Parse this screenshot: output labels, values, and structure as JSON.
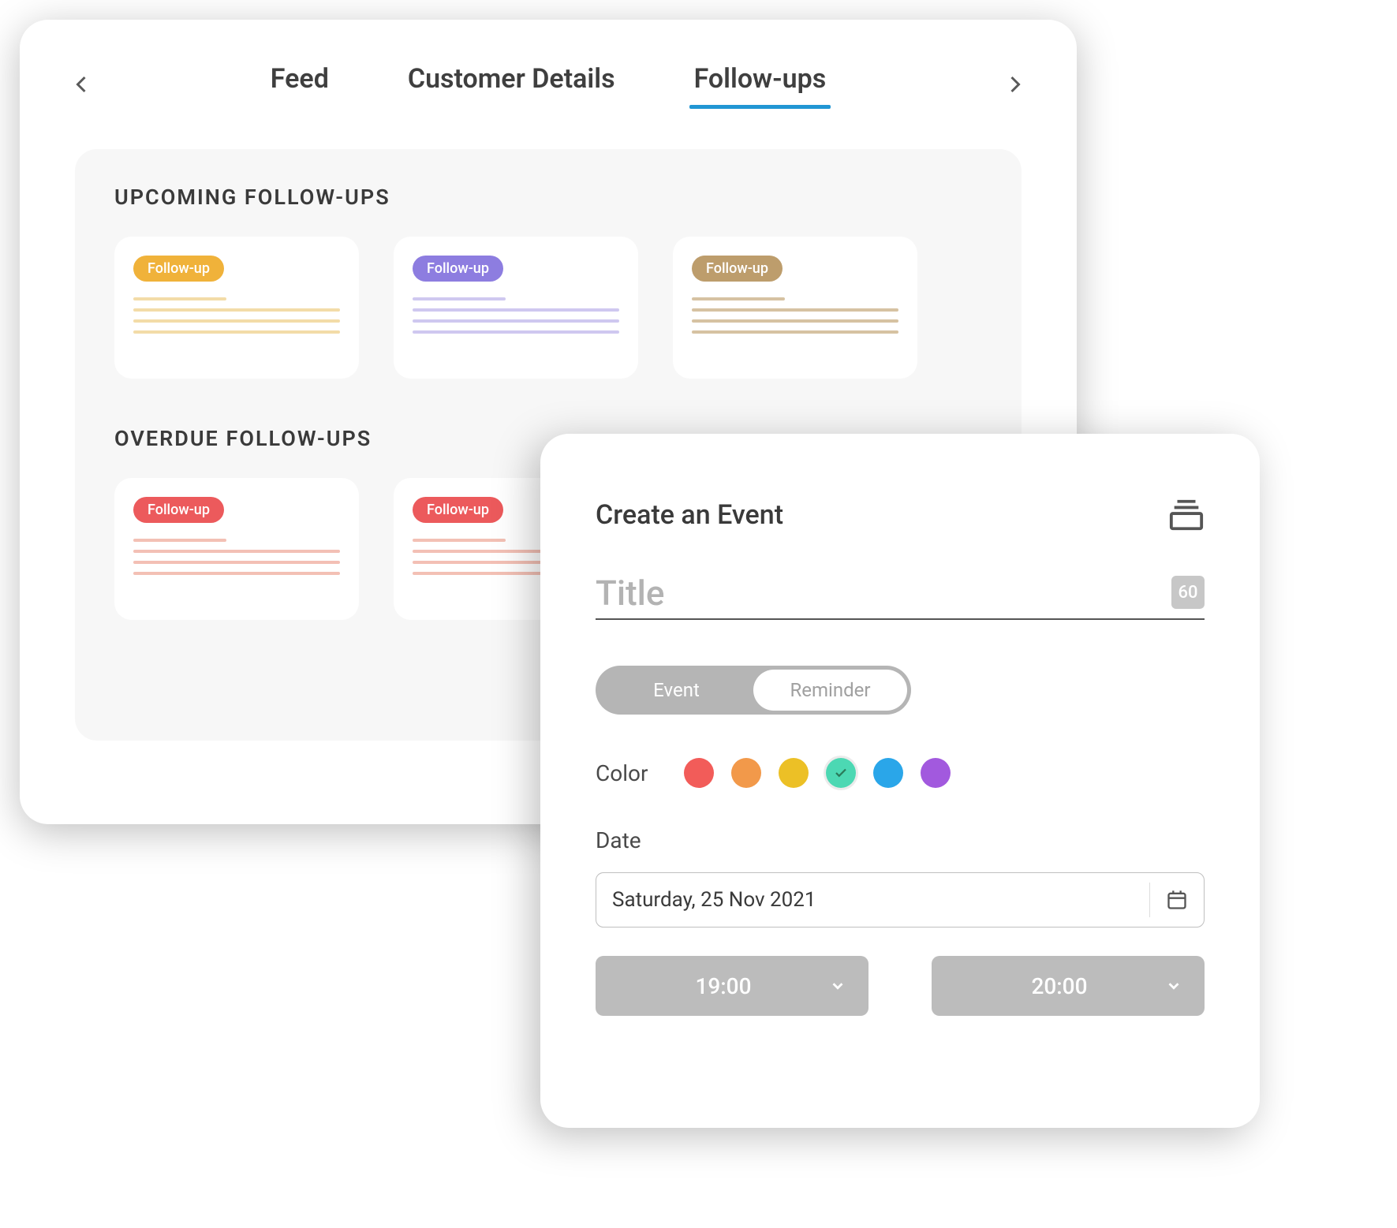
{
  "tabs": {
    "items": [
      {
        "label": "Feed",
        "active": false
      },
      {
        "label": "Customer Details",
        "active": false
      },
      {
        "label": "Follow-ups",
        "active": true
      }
    ]
  },
  "sections": {
    "upcoming": {
      "title": "UPCOMING FOLLOW-UPS",
      "cards": [
        {
          "badge": "Follow-up",
          "variant": "amber"
        },
        {
          "badge": "Follow-up",
          "variant": "purple"
        },
        {
          "badge": "Follow-up",
          "variant": "tan"
        }
      ]
    },
    "overdue": {
      "title": "OVERDUE FOLLOW-UPS",
      "cards": [
        {
          "badge": "Follow-up",
          "variant": "red"
        },
        {
          "badge": "Follow-up",
          "variant": "red"
        }
      ]
    }
  },
  "eventPanel": {
    "heading": "Create an Event",
    "titlePlaceholder": "Title",
    "titleCharLimit": "60",
    "segmented": {
      "option1": "Event",
      "option2": "Reminder",
      "selected": "Reminder"
    },
    "colorLabel": "Color",
    "colors": [
      {
        "name": "red",
        "hex": "#f25c59",
        "selected": false
      },
      {
        "name": "orange",
        "hex": "#f2994a",
        "selected": false
      },
      {
        "name": "yellow",
        "hex": "#ecc026",
        "selected": false
      },
      {
        "name": "teal",
        "hex": "#4cd8b3",
        "selected": true
      },
      {
        "name": "blue",
        "hex": "#2aa6e9",
        "selected": false
      },
      {
        "name": "purple",
        "hex": "#a259de",
        "selected": false
      }
    ],
    "dateLabel": "Date",
    "dateValue": "Saturday, 25 Nov 2021",
    "startTime": "19:00",
    "endTime": "20:00"
  }
}
